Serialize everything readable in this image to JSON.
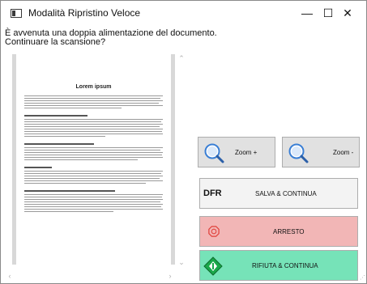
{
  "window": {
    "title": "Modalità Ripristino Veloce",
    "minimize_glyph": "—",
    "maximize_glyph": "☐",
    "close_glyph": "✕"
  },
  "prompt": {
    "line1": "È avvenuta una doppia alimentazione del documento.",
    "line2": "Continuare la scansione?"
  },
  "preview": {
    "page_title": "Lorem ipsum"
  },
  "buttons": {
    "zoom_in": "Zoom +",
    "zoom_out": "Zoom -",
    "save_prefix": "DFR",
    "save_continue": "SALVA & CONTINUA",
    "stop": "ARRESTO",
    "refuse_continue": "RIFIUTA & CONTINUA"
  },
  "colors": {
    "stop_bg": "#f2b6b6",
    "refuse_bg": "#76e3b8",
    "save_bg": "#f3f3f3",
    "zoom_bg": "#e1e1e1",
    "icon_blue": "#3a7fd5",
    "icon_red": "#e0403a",
    "icon_green": "#1aa84a"
  },
  "icons": {
    "app": "window-icon",
    "zoom_in": "magnifier-plus-icon",
    "zoom_out": "magnifier-minus-icon",
    "stop": "stop-sign-icon",
    "refuse": "green-diamond-arrow-icon"
  }
}
